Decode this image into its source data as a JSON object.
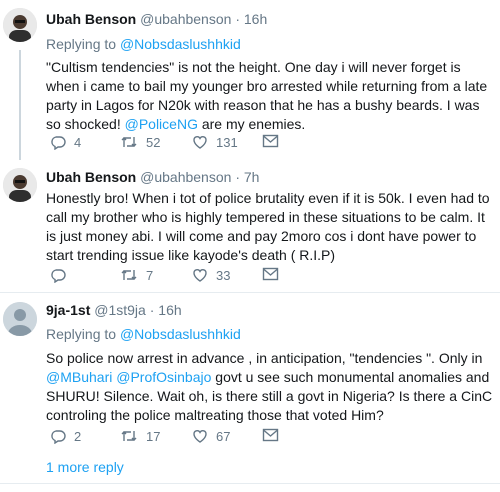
{
  "tweets": [
    {
      "name": "Ubah Benson",
      "handle": "@ubahbenson",
      "time": "16h",
      "replying_label": "Replying to",
      "replying_to": "@Nobsdaslushhkid",
      "text_a": "\"Cultism tendencies\" is not the height. One day i will never forget is when i came to bail my younger bro arrested while returning from a late party in Lagos for N20k with reason that he has a bushy beards. I was so shocked! ",
      "mention": "@PoliceNG",
      "text_b": "  are my enemies.",
      "replies": "4",
      "retweets": "52",
      "likes": "131"
    },
    {
      "name": "Ubah Benson",
      "handle": "@ubahbenson",
      "time": "7h",
      "text": "Honestly bro! When i tot of police brutality even if it is 50k. I even had to call my brother who is highly tempered in these situations to be calm. It is just money abi. I will come and pay 2moro cos i dont have power to start trending issue like kayode's death ( R.I.P)",
      "replies": "",
      "retweets": "7",
      "likes": "33"
    },
    {
      "name": "9ja-1st",
      "handle": "@1st9ja",
      "time": "16h",
      "replying_label": "Replying to",
      "replying_to": "@Nobsdaslushhkid",
      "text_a": "So police now arrest in advance , in anticipation,  \"tendencies \". Only in ",
      "mention_a": "@MBuhari",
      "mention_b": "@ProfOsinbajo",
      "text_b": " govt u see such monumental anomalies and SHURU! Silence.  Wait oh,  is there still a govt in Nigeria?  Is there a CinC controling the police maltreating those that  voted Him?",
      "replies": "2",
      "retweets": "17",
      "likes": "67"
    }
  ],
  "more_replies": "1 more reply",
  "colors": {
    "link": "#1da1f2",
    "muted": "#657786",
    "divider": "#e6ecf0"
  },
  "icons": [
    "reply-icon",
    "retweet-icon",
    "like-icon",
    "mail-icon"
  ]
}
